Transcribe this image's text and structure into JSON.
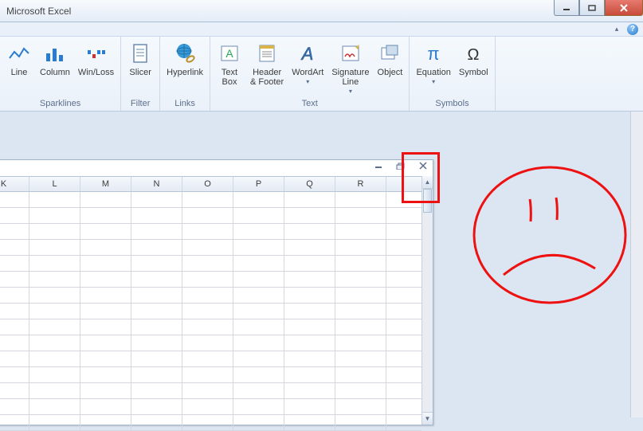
{
  "title": "Microsoft Excel",
  "ribbon": {
    "groups": {
      "sparklines": {
        "label": "Sparklines",
        "line": "Line",
        "column": "Column",
        "winloss": "Win/Loss"
      },
      "filter": {
        "label": "Filter",
        "slicer": "Slicer"
      },
      "links": {
        "label": "Links",
        "hyperlink": "Hyperlink"
      },
      "text": {
        "label": "Text",
        "textbox": "Text\nBox",
        "headerfooter": "Header\n& Footer",
        "wordart": "WordArt",
        "signature": "Signature\nLine",
        "object": "Object"
      },
      "symbols": {
        "label": "Symbols",
        "equation": "Equation",
        "symbol": "Symbol"
      }
    }
  },
  "help_char": "?",
  "collapse_char": "▴",
  "columns": [
    "K",
    "L",
    "M",
    "N",
    "O",
    "P",
    "Q",
    "R"
  ]
}
